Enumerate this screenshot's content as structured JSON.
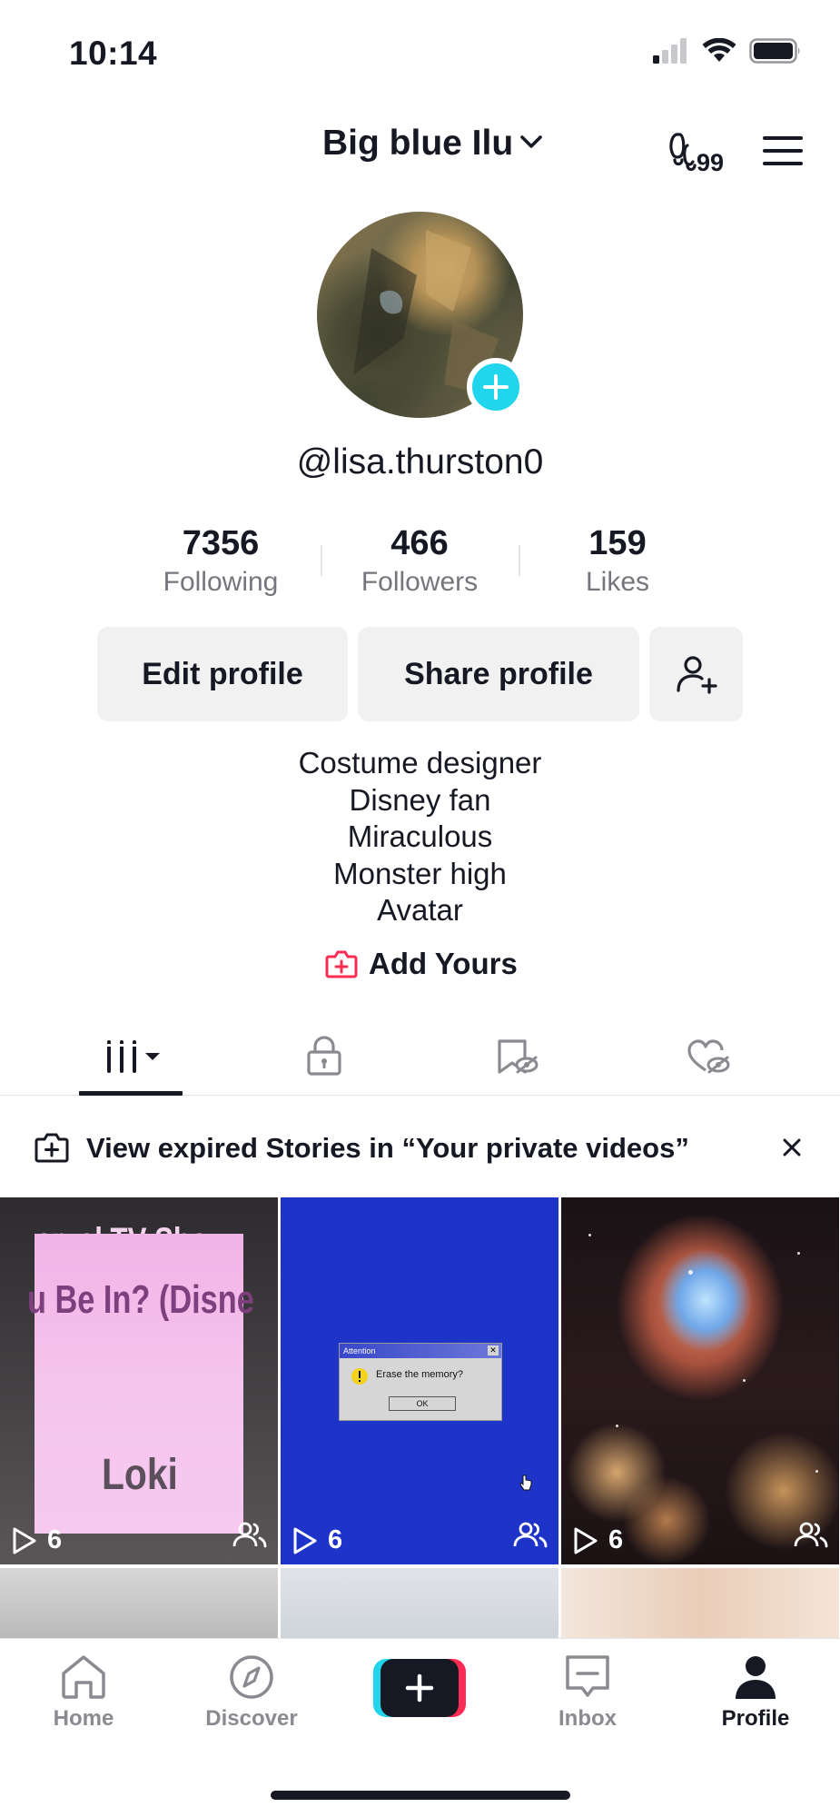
{
  "status_bar": {
    "time": "10:14"
  },
  "header": {
    "account_name": "Big blue Ilu",
    "friends_badge": "99"
  },
  "profile": {
    "username": "@lisa.thurston0",
    "stats": [
      {
        "value": "7356",
        "label": "Following"
      },
      {
        "value": "466",
        "label": "Followers"
      },
      {
        "value": "159",
        "label": "Likes"
      }
    ],
    "buttons": {
      "edit": "Edit profile",
      "share": "Share profile"
    },
    "bio_lines": [
      "Costume designer",
      "Disney fan",
      "Miraculous",
      "Monster high",
      "Avatar"
    ],
    "add_yours": "Add Yours"
  },
  "banner": {
    "text": "View expired Stories in “Your private videos”"
  },
  "videos": [
    {
      "views": "6",
      "overlay_line1": "arvel TV Show",
      "overlay_line2": "u Be In? (Disne",
      "overlay_name": "Loki"
    },
    {
      "views": "6",
      "dialog_title": "Attention",
      "dialog_message": "Erase the memory?",
      "dialog_ok": "OK"
    },
    {
      "views": "6"
    }
  ],
  "bottom_nav": {
    "home": "Home",
    "discover": "Discover",
    "inbox": "Inbox",
    "profile": "Profile"
  },
  "colors": {
    "accent_cyan": "#20d5ec",
    "accent_red": "#fe2c55",
    "text_dark": "#161823",
    "muted": "#75767c"
  }
}
